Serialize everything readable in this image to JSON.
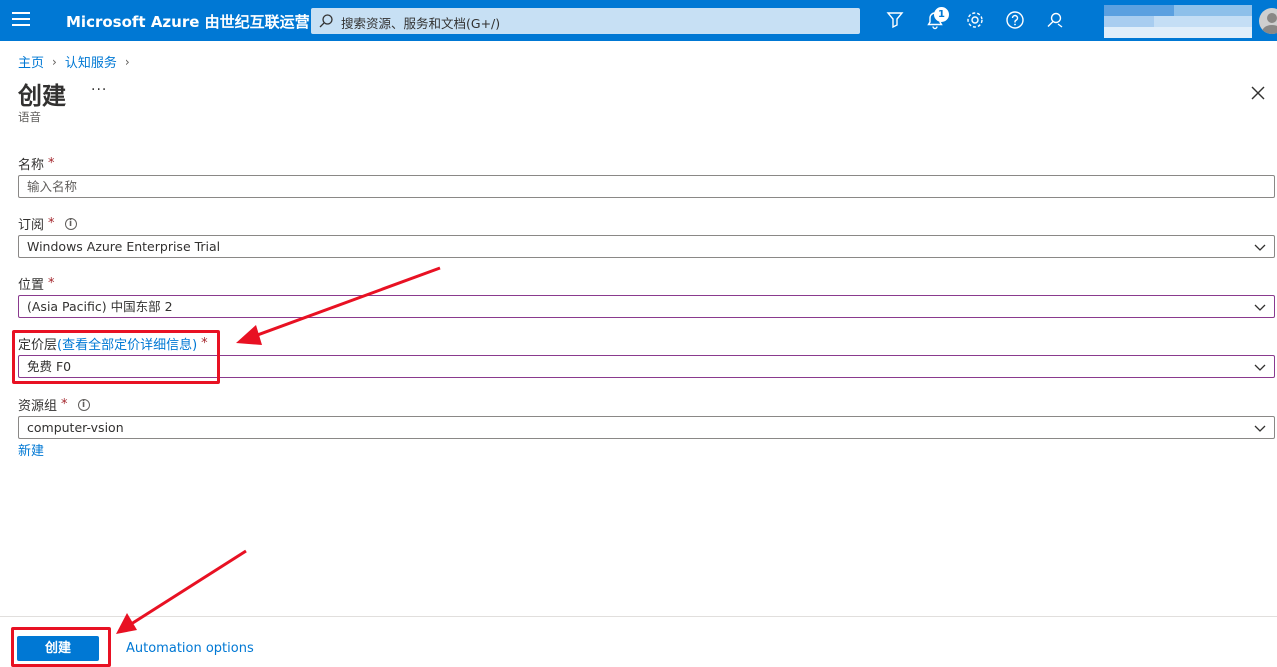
{
  "topbar": {
    "brand": "Microsoft Azure 由世纪互联运营",
    "search_placeholder": "搜索资源、服务和文档(G+/)",
    "notification_count": "1"
  },
  "breadcrumb": {
    "items": [
      "主页",
      "认知服务"
    ]
  },
  "page": {
    "title": "创建",
    "more": "···",
    "subtitle": "语音"
  },
  "form": {
    "name": {
      "label": "名称",
      "required": "*",
      "placeholder": "输入名称"
    },
    "subscription": {
      "label": "订阅",
      "required": "*",
      "value": "Windows Azure Enterprise Trial"
    },
    "location": {
      "label": "位置",
      "required": "*",
      "value": "(Asia Pacific) 中国东部 2"
    },
    "pricing_tier": {
      "label": "定价层",
      "link_text": "(查看全部定价详细信息)",
      "required": "*",
      "value": "免费 F0"
    },
    "resource_group": {
      "label": "资源组",
      "required": "*",
      "value": "computer-vsion",
      "new_link": "新建"
    }
  },
  "footer": {
    "create_label": "创建",
    "automation_label": "Automation options"
  },
  "colors": {
    "azure_blue": "#0078d4",
    "annotation_red": "#e81123",
    "required_red": "#a4262c"
  }
}
